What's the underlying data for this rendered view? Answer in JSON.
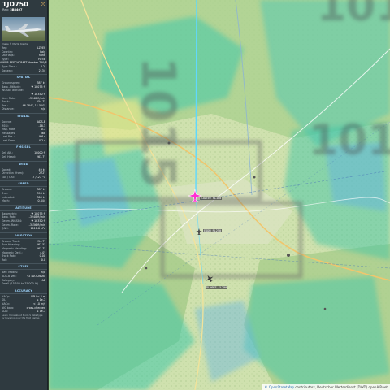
{
  "aircraft": {
    "callsign": "TJD750",
    "reg_label": "Reg:",
    "reg_value": "3B8407",
    "image_caption": "Image © Martin Kiekhe",
    "details": [
      {
        "k": "Reg:",
        "v": "LZ2EF"
      },
      {
        "k": "Country:",
        "v": "Italy"
      },
      {
        "k": "DB Flags:",
        "v": "none"
      },
      {
        "k": "Type:",
        "v": "H25B"
      }
    ],
    "type_full": "HAWKER BEECHCRAFT Hawker 750/850",
    "type_rows": [
      {
        "k": "Type Desc.:",
        "v": "L2J"
      },
      {
        "k": "Squawk:",
        "v": "2134"
      }
    ]
  },
  "sections": [
    {
      "title": "SPATIAL",
      "rows": [
        {
          "k": "Groundspeed:",
          "v": "387 kt"
        },
        {
          "k": "Baro. Altitude:",
          "v": "▼ 18075 ft"
        },
        {
          "k": "WGS84 altitude:",
          "v": ""
        },
        {
          "k": "",
          "v": "▼ 18350 ft"
        },
        {
          "k": "Vert. Rate:",
          "v": "-3248 ft/min"
        },
        {
          "k": "Track:",
          "v": "254.7°"
        },
        {
          "k": "Pos.:",
          "v": "46.784°, 11.510°"
        },
        {
          "k": "Distance:",
          "v": "n/a"
        }
      ]
    },
    {
      "title": "SIGNAL",
      "rows": [
        {
          "k": "Source:",
          "v": "ADS-B"
        },
        {
          "k": "RSSI:",
          "v": "-18.3"
        },
        {
          "k": "Msg. Rate:",
          "v": "0.7"
        },
        {
          "k": "Messages:",
          "v": "368"
        },
        {
          "k": "Last Pos.:",
          "v": "9.6 s"
        },
        {
          "k": "Last Seen:",
          "v": "0.2 s"
        }
      ]
    },
    {
      "title": "FMS SEL",
      "rows": [
        {
          "k": "Sel. Alt.:",
          "v": "10000 ft"
        },
        {
          "k": "Sel. Head.:",
          "v": "263.7°"
        }
      ]
    },
    {
      "title": "WIND",
      "rows": [
        {
          "k": "Speed:",
          "v": "49 kt"
        },
        {
          "k": "Direction (from):",
          "v": "272°"
        },
        {
          "k": "TAT / OAT:",
          "v": "-7 / -27 °C"
        }
      ]
    },
    {
      "title": "SPEED",
      "rows": [
        {
          "k": "Ground:",
          "v": "387 kt"
        },
        {
          "k": "True:",
          "v": "396 kt"
        },
        {
          "k": "Indicated:",
          "v": "304 kt"
        },
        {
          "k": "Mach:",
          "v": "0.644"
        }
      ]
    },
    {
      "title": "ALTITUDE",
      "rows": [
        {
          "k": "Barometric:",
          "v": "▼ 18075 ft"
        },
        {
          "k": "Baro. Rate:",
          "v": "-3248 ft/min"
        },
        {
          "k": "Geom. WGS84:",
          "v": "▼ 18350 ft"
        },
        {
          "k": "Geom. Rate:",
          "v": "-3156 ft/min"
        },
        {
          "k": "QNH:",
          "v": "1011.8 hPa"
        }
      ]
    },
    {
      "title": "DIRECTION",
      "rows": [
        {
          "k": "Ground Track:",
          "v": "254.7°"
        },
        {
          "k": "True Heading:",
          "v": "267.5°"
        },
        {
          "k": "Magnetic Heading:",
          "v": "263.7°"
        },
        {
          "k": "Magnetic Decl.:",
          "v": "4.0°"
        },
        {
          "k": "Track Rate:",
          "v": "0.00"
        },
        {
          "k": "Roll:",
          "v": "0.0"
        }
      ]
    },
    {
      "title": "STUFF",
      "rows": [
        {
          "k": "Nav. Modes:",
          "v": "n/a"
        },
        {
          "k": "ADS-B Ver.:",
          "v": "v2 (DO-260B)"
        },
        {
          "k": "Category:",
          "v": "A2"
        },
        {
          "k": "Small (15'500 to 75'000 lb)",
          "v": ""
        }
      ]
    },
    {
      "title": "ACCURACY",
      "rows": [
        {
          "k": "NACp:",
          "v": "EPU < 3 m"
        },
        {
          "k": "SIL:",
          "v": "≤ 1e-7"
        },
        {
          "k": "NACv:",
          "v": "< 10 m/s"
        },
        {
          "k": "NIC baro:",
          "v": "cross-checked"
        },
        {
          "k": "SDA:",
          "v": "≤ 1e-7"
        }
      ]
    }
  ],
  "footer_text": "Learn more about Mode S data type by hovering over the field names",
  "map": {
    "labels": {
      "label_a": "TJD750 FL180",
      "label_b": "EDDM FL250",
      "label_c": "DLH6KE FL290"
    },
    "attribution_link": "© OpenStreetMap",
    "attribution_text": " contributors, Deutscher Wetterdienst (DWD) openAIP.net",
    "colors": {
      "marker": "#ff2fd1",
      "track": "#5fd8ff",
      "forest": "#a8cf8c",
      "rain_light": "#3ec9a9",
      "rain_med": "#64b6e0"
    }
  }
}
